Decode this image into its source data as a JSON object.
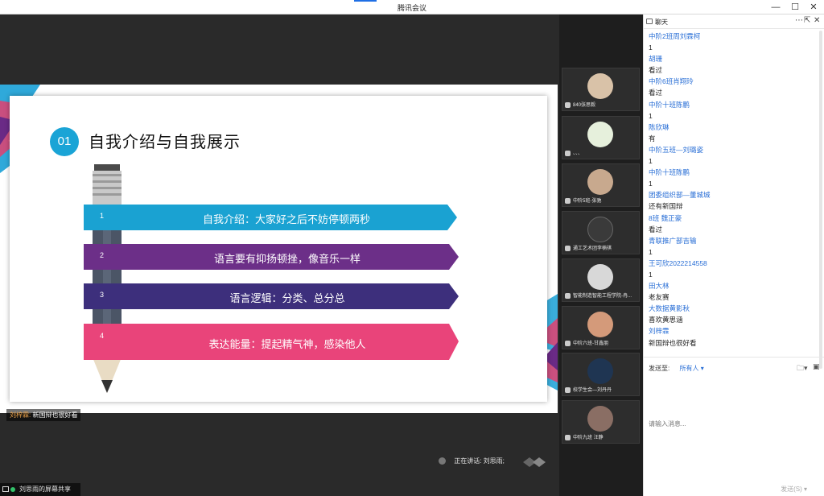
{
  "window": {
    "title": "腾讯会议"
  },
  "slide": {
    "number": "01",
    "title": "自我介绍与自我展示",
    "items": [
      {
        "n": "1",
        "text": "自我介绍：大家好之后不妨停顿两秒",
        "color": "#1aa2d2"
      },
      {
        "n": "2",
        "text": "语言要有抑扬顿挫，像音乐一样",
        "color": "#6c2f88"
      },
      {
        "n": "3",
        "text": "语言逻辑：分类、总分总",
        "color": "#3d2f7c"
      },
      {
        "n": "4",
        "text": "表达能量：提起精气神，感染他人",
        "color": "#e9447a"
      }
    ]
  },
  "danmaku": {
    "user": "刘梓霖:",
    "text": "新国辩也很好看"
  },
  "speaking": "正在讲话: 刘思雨;",
  "share_label": "刘思雨的屏幕共享",
  "participants": [
    {
      "name": "840张思毅"
    },
    {
      "name": "、、、"
    },
    {
      "name": "中阶5班-张驰"
    },
    {
      "name": "通工艺术团李楠祺"
    },
    {
      "name": "智能制造智能工程学院-冉..."
    },
    {
      "name": "中阶六班-甘鑫朋"
    },
    {
      "name": "校学生会—刘丹丹"
    },
    {
      "name": "中阶九班 汪静"
    }
  ],
  "chat": {
    "title": "聊天",
    "messages": [
      {
        "name": "中阶2班周刘霖柯",
        "text": "1"
      },
      {
        "name": "胡珊",
        "text": "看过"
      },
      {
        "name": "中阶6班肖翔玲",
        "text": "看过"
      },
      {
        "name": "中阶十班陈鹏",
        "text": "1"
      },
      {
        "name": "陈欣琳",
        "text": "有"
      },
      {
        "name": "中阶五班—刘璐姿",
        "text": "1"
      },
      {
        "name": "中阶十班陈鹏",
        "text": "1"
      },
      {
        "name": "团委组织部—董城城",
        "text": "还有新国辩"
      },
      {
        "name": "8班 魏正豪",
        "text": "看过"
      },
      {
        "name": "青联推广部吉输",
        "text": "1"
      },
      {
        "name": "王可欣2022214558",
        "text": "1"
      },
      {
        "name": "田大林",
        "text": "老友赛"
      },
      {
        "name": "大数据黄影秋",
        "text": "喜欢黄思涵"
      },
      {
        "name": "刘梓霖",
        "text": "新国辩也很好看"
      }
    ],
    "send_to_label": "发送至:",
    "send_to_value": "所有人",
    "input_placeholder": "请输入消息...",
    "send_label": "发送(S)"
  }
}
